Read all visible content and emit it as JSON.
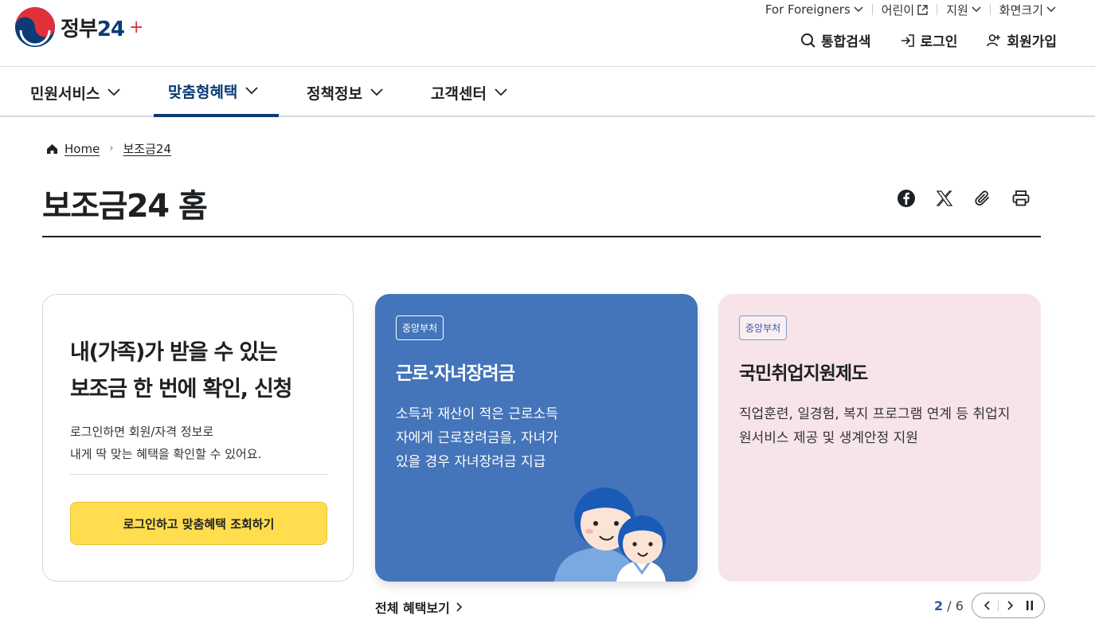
{
  "header": {
    "logo_text": "정부",
    "logo_number": "24",
    "utility": [
      {
        "label": "For Foreigners",
        "icon": "chevron-down-icon"
      },
      {
        "label": "어린이",
        "icon": "external-link-icon"
      },
      {
        "label": "지원",
        "icon": "chevron-down-icon"
      },
      {
        "label": "화면크기",
        "icon": "chevron-down-icon"
      }
    ],
    "actions": {
      "search": "통합검색",
      "login": "로그인",
      "signup": "회원가입"
    }
  },
  "gnb": {
    "items": [
      "민원서비스",
      "맞춤형혜택",
      "정책정보",
      "고객센터"
    ],
    "active_index": 1
  },
  "breadcrumb": {
    "home": "Home",
    "current": "보조금24"
  },
  "page_title": "보조금24 홈",
  "login_card": {
    "headline_1": "내(가족)가 받을 수 있는",
    "headline_2": "보조금 한 번에 확인, 신청",
    "desc_1": "로그인하면 회원/자격 정보로",
    "desc_2": "내게 딱 맞는 혜택을 확인할 수 있어요.",
    "button": "로그인하고 맞춤혜택 조회하기"
  },
  "benefit_cards": [
    {
      "badge": "중앙부처",
      "title": "근로·자녀장려금",
      "desc": "소득과 재산이 적은 근로소득자에게 근로장려금을, 자녀가 있을 경우 자녀장려금 지급",
      "bg": "#4474b9"
    },
    {
      "badge": "중앙부처",
      "title": "국민취업지원제도",
      "desc": "직업훈련, 일경험, 복지 프로그램 연계 등 취업지원서비스 제공 및 생계안정 지원",
      "bg": "#f7e4e9"
    }
  ],
  "footer_row": {
    "all_link": "전체 혜택보기",
    "page_current": "2",
    "page_total": "/ 6"
  },
  "colors": {
    "brand_navy": "#0b3b75",
    "accent_yellow": "#ffdd4f",
    "card_blue": "#4474b9",
    "card_pink": "#f7e4e9"
  }
}
